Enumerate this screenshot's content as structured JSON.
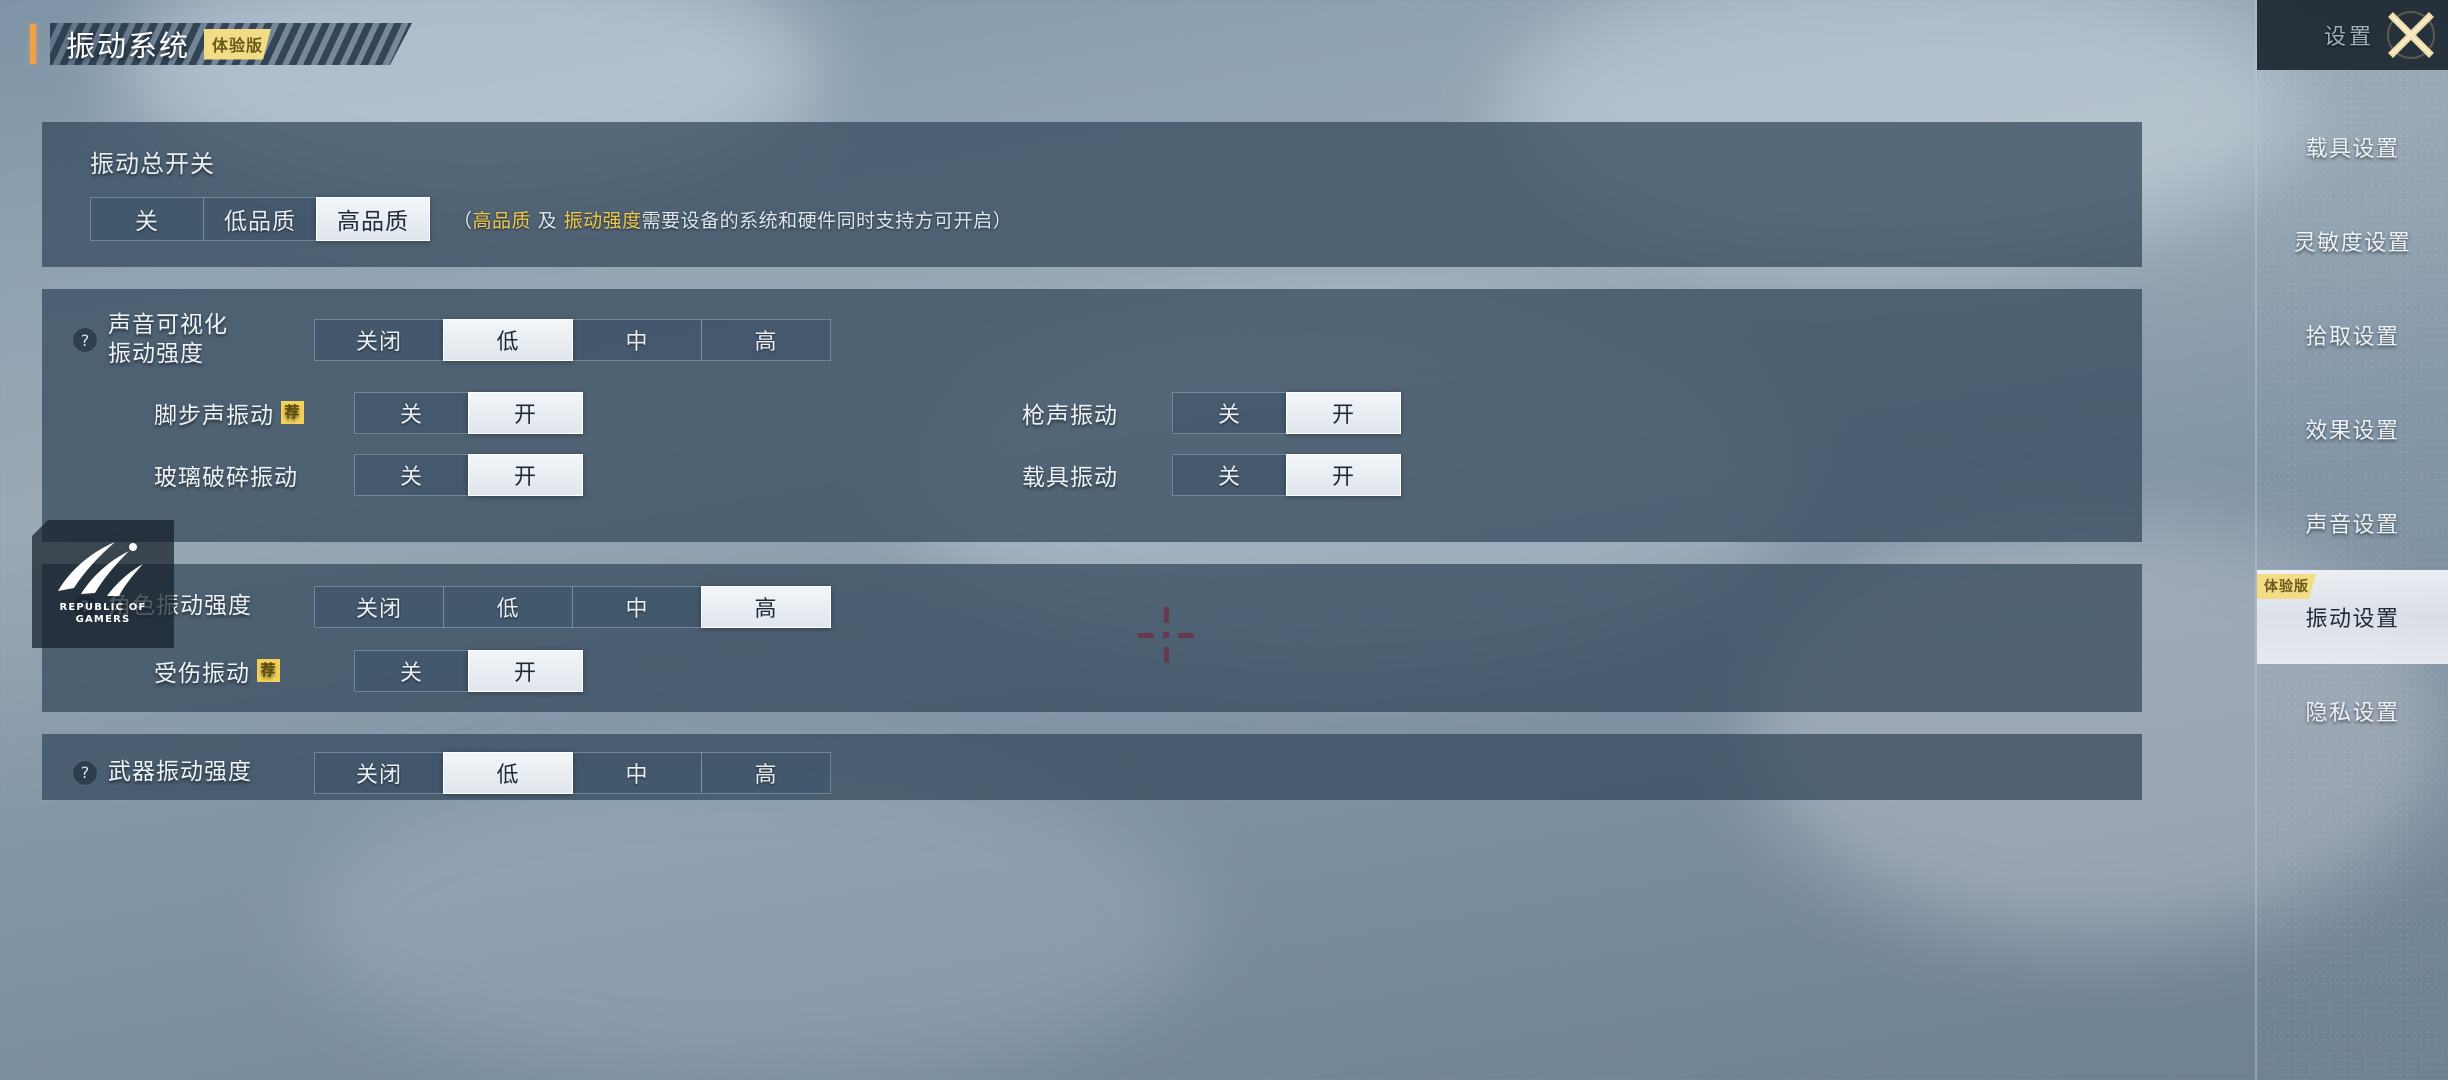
{
  "page": {
    "title": "振动系统",
    "title_badge": "体验版"
  },
  "master": {
    "label": "振动总开关",
    "options": [
      "关",
      "低品质",
      "高品质"
    ],
    "selected": "高品质",
    "hint_open": "（",
    "hint_hl1": "高品质",
    "hint_mid": " 及 ",
    "hint_hl2": "振动强度",
    "hint_tail": "需要设备的系统和硬件同时支持方可开启）"
  },
  "sound_section": {
    "help_icon": "question-mark-icon",
    "strength_label_line1": "声音可视化",
    "strength_label_line2": "振动强度",
    "strength_options": [
      "关闭",
      "低",
      "中",
      "高"
    ],
    "strength_selected": "低",
    "rows": [
      {
        "label": "脚步声振动",
        "badge": "荐",
        "options": [
          "关",
          "开"
        ],
        "selected": "开"
      },
      {
        "label": "枪声振动",
        "badge": "",
        "options": [
          "关",
          "开"
        ],
        "selected": "开"
      },
      {
        "label": "玻璃破碎振动",
        "badge": "",
        "options": [
          "关",
          "开"
        ],
        "selected": "开"
      },
      {
        "label": "载具振动",
        "badge": "",
        "options": [
          "关",
          "开"
        ],
        "selected": "开"
      }
    ]
  },
  "character_section": {
    "help_icon": "question-mark-icon",
    "strength_label": "角色振动强度",
    "strength_options": [
      "关闭",
      "低",
      "中",
      "高"
    ],
    "strength_selected": "高",
    "rows": [
      {
        "label": "受伤振动",
        "badge": "荐",
        "options": [
          "关",
          "开"
        ],
        "selected": "开"
      }
    ]
  },
  "weapon_section": {
    "help_icon": "question-mark-icon",
    "strength_label": "武器振动强度",
    "strength_options": [
      "关闭",
      "低",
      "中",
      "高"
    ],
    "strength_selected": "低"
  },
  "watermark": {
    "logo": "rog-logo-icon",
    "line1": "REPUBLIC OF",
    "line2": "GAMERS"
  },
  "sidebar": {
    "header_title": "设置",
    "close_icon": "close-x-icon",
    "items": [
      {
        "label": "载具设置",
        "active": false,
        "badge": ""
      },
      {
        "label": "灵敏度设置",
        "active": false,
        "badge": ""
      },
      {
        "label": "拾取设置",
        "active": false,
        "badge": ""
      },
      {
        "label": "效果设置",
        "active": false,
        "badge": ""
      },
      {
        "label": "声音设置",
        "active": false,
        "badge": ""
      },
      {
        "label": "振动设置",
        "active": true,
        "badge": "体验版"
      },
      {
        "label": "隐私设置",
        "active": false,
        "badge": ""
      }
    ]
  },
  "colors": {
    "accent_gold": "#f2dd84",
    "title_bar": "#f0a04b",
    "crosshair_red": "#f0142f",
    "panel_bg": "#32465a",
    "selected_fill": "#eef3f8"
  }
}
